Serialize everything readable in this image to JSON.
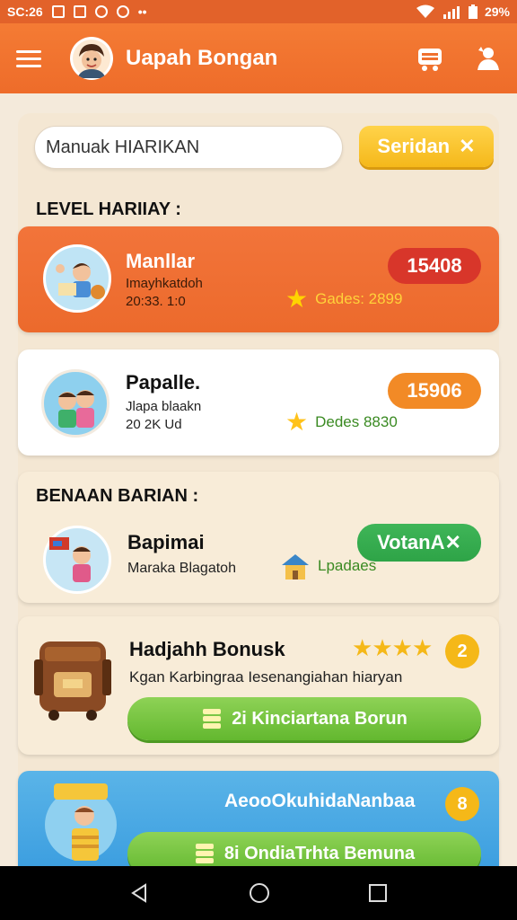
{
  "status_bar": {
    "time": "SC:26",
    "battery": "29%"
  },
  "app_bar": {
    "title": "Uapah Bongan",
    "menu_icon": "menu-icon",
    "cart_icon": "cart-icon",
    "profile_icon": "profile-icon"
  },
  "search": {
    "value": "Manuak HIARIKAN",
    "button_label": "Seridan"
  },
  "sections": {
    "level": "LEVEL HARIIAY :",
    "bonus": "BENAAN BARIAN :"
  },
  "cards": [
    {
      "name": "Manllar",
      "sub1": "Imayhkatdoh",
      "sub2": "20:33. 1:0",
      "score": "15408",
      "meta": "Gades: 2899",
      "score_color": "#d8362a"
    },
    {
      "name": "Papalle.",
      "sub1": "Jlapa blaakn",
      "sub2": "20 2K Ud",
      "score": "15906",
      "meta": "Dedes 8830",
      "score_color": "#f28a26"
    }
  ],
  "bonus_card": {
    "name": "Bapimai",
    "sub": "Maraka Blagatoh",
    "meta": "Lpadaes",
    "button": "VotanA"
  },
  "reward_card": {
    "title": "Hadjahh Bonusk",
    "desc": "Kgan Karbingraa Iesenangiahan hiaryan",
    "badge": "2",
    "button": "2i Kinciartana Borun",
    "stars": 4
  },
  "promo_card": {
    "title": "AeooOkuhidaNanbaa",
    "badge": "8",
    "button": "8i OndiaTrhta Bemuna"
  }
}
